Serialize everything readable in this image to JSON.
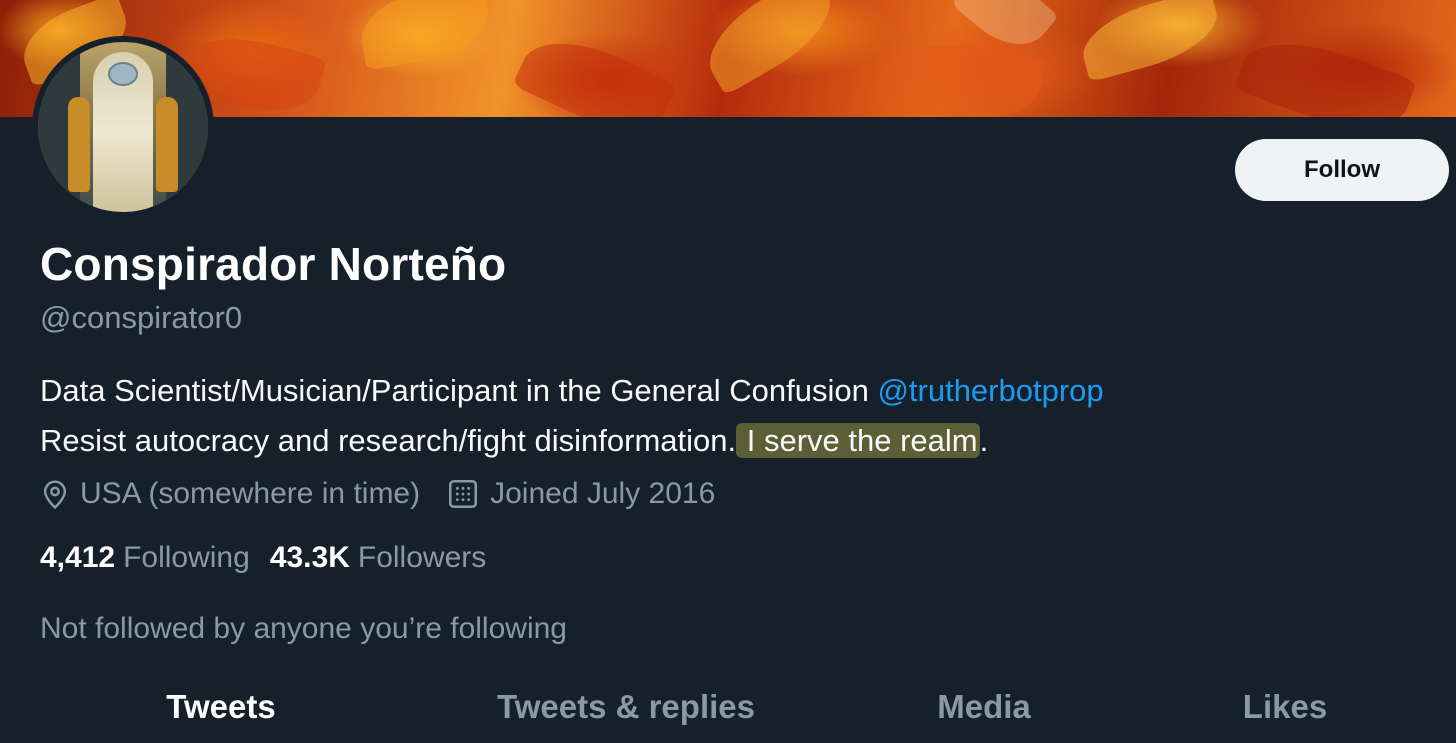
{
  "profile": {
    "display_name": "Conspirador Norteño",
    "handle": "@conspirator0",
    "bio_line1": "Data Scientist/Musician/Participant in the General Confusion ",
    "bio_mention": "@trutherbotprop",
    "bio_line2_a": "Resist autocracy and research/fight disinformation.",
    "bio_line2_highlight": " I serve the realm",
    "bio_line2_end": ".",
    "location": "USA (somewhere in time)",
    "joined": "Joined July 2016",
    "following_count": "4,412",
    "following_label": "Following",
    "followers_count": "43.3K",
    "followers_label": "Followers",
    "followed_by_note": "Not followed by anyone you’re following"
  },
  "actions": {
    "follow_label": "Follow"
  },
  "tabs": [
    {
      "label": "Tweets",
      "active": true
    },
    {
      "label": "Tweets & replies",
      "active": false
    },
    {
      "label": "Media",
      "active": false
    },
    {
      "label": "Likes",
      "active": false
    }
  ],
  "colors": {
    "background": "#15202b",
    "link": "#1d9bf0",
    "muted": "#8b98a5",
    "highlight": "#bdb446"
  },
  "icons": {
    "location": "location-pin-icon",
    "joined": "calendar-icon"
  }
}
